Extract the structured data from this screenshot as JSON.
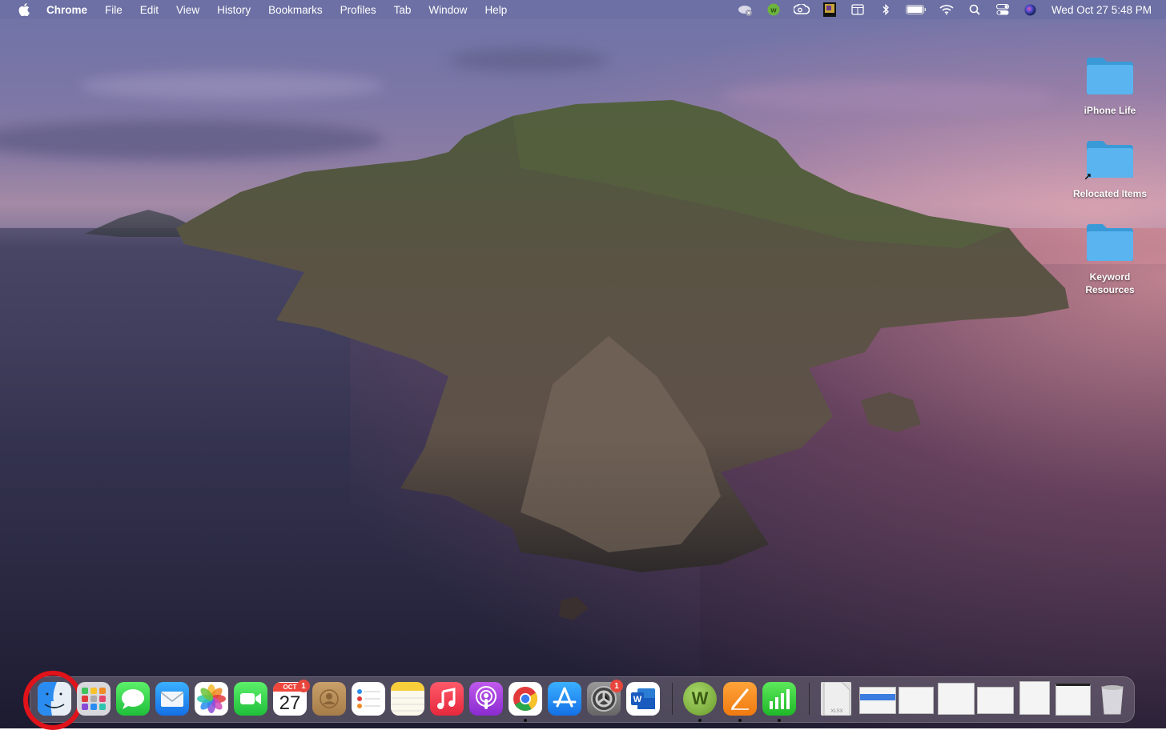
{
  "menubar": {
    "app_name": "Chrome",
    "menus": [
      "File",
      "Edit",
      "View",
      "History",
      "Bookmarks",
      "Profiles",
      "Tab",
      "Window",
      "Help"
    ],
    "status_icons": [
      "creative-cloud-sync-icon",
      "webroot-icon",
      "adobe-creative-cloud-icon",
      "app-status-icon",
      "window-tiler-icon",
      "bluetooth-icon",
      "battery-icon",
      "wifi-icon",
      "spotlight-search-icon",
      "control-center-icon",
      "siri-icon"
    ],
    "clock": "Wed Oct 27  5:48 PM"
  },
  "desktop_icons": [
    {
      "label": "iPhone Life",
      "type": "folder"
    },
    {
      "label": "Relocated Items",
      "type": "folder-alias"
    },
    {
      "label": "Keyword Resources",
      "type": "folder"
    }
  ],
  "dock": {
    "apps": [
      {
        "name": "Finder",
        "icon": "finder-icon",
        "highlighted": true
      },
      {
        "name": "Launchpad",
        "icon": "launchpad-icon"
      },
      {
        "name": "Messages",
        "icon": "messages-icon"
      },
      {
        "name": "Mail",
        "icon": "mail-icon"
      },
      {
        "name": "Photos",
        "icon": "photos-icon"
      },
      {
        "name": "FaceTime",
        "icon": "facetime-icon"
      },
      {
        "name": "Calendar",
        "icon": "calendar-icon",
        "month": "OCT",
        "day": "27",
        "badge": "1"
      },
      {
        "name": "Contacts",
        "icon": "contacts-icon"
      },
      {
        "name": "Reminders",
        "icon": "reminders-icon"
      },
      {
        "name": "Notes",
        "icon": "notes-icon"
      },
      {
        "name": "Music",
        "icon": "music-icon"
      },
      {
        "name": "Podcasts",
        "icon": "podcasts-icon"
      },
      {
        "name": "Google Chrome",
        "icon": "chrome-icon",
        "running": true
      },
      {
        "name": "App Store",
        "icon": "app-store-icon"
      },
      {
        "name": "System Preferences",
        "icon": "system-preferences-icon",
        "badge": "1"
      },
      {
        "name": "Microsoft Word",
        "icon": "word-icon",
        "letter": "W"
      }
    ],
    "recent_apps": [
      {
        "name": "Webroot",
        "icon": "webroot-icon",
        "letter": "W",
        "running": true
      },
      {
        "name": "Pages",
        "icon": "pages-icon",
        "running": true
      },
      {
        "name": "Numbers",
        "icon": "numbers-icon",
        "running": true
      }
    ],
    "stack_items": [
      {
        "name": "XLSX file",
        "icon": "xlsx-file-icon",
        "label": "XLSX"
      },
      {
        "name": "Finder window",
        "icon": "finder-window-thumbnail"
      },
      {
        "name": "Numbers window",
        "icon": "numbers-window-thumbnail"
      },
      {
        "name": "Chrome window",
        "icon": "chrome-window-thumbnail"
      },
      {
        "name": "Finder window 2",
        "icon": "finder-window-thumbnail"
      },
      {
        "name": "Pages window",
        "icon": "pages-window-thumbnail"
      },
      {
        "name": "Chrome window 2",
        "icon": "chrome-window-thumbnail"
      },
      {
        "name": "Trash",
        "icon": "trash-icon"
      }
    ]
  },
  "colors": {
    "highlight_ring": "#e0121a",
    "folder_blue": "#5ab4ef",
    "badge_red": "#e8453c"
  }
}
